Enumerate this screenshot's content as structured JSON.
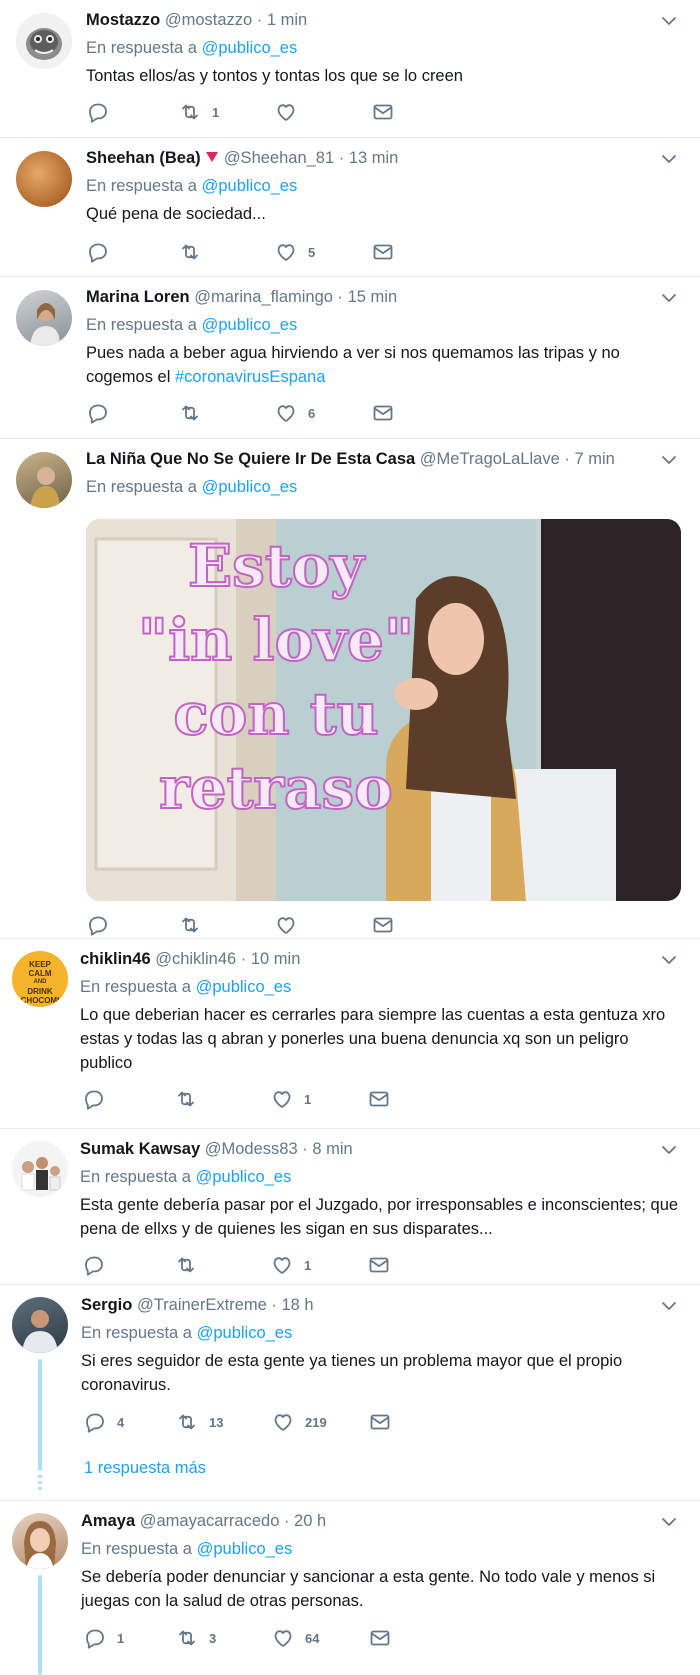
{
  "replying_prefix": "En respuesta a",
  "tweets": [
    {
      "name": "Mostazzo",
      "handle": "@mostazzo",
      "time": "1 min",
      "reply_to": "@publico_es",
      "text": "Tontas ellos/as y tontos y tontas los que se lo creen",
      "counts": {
        "reply": "",
        "retweet": "1",
        "like": "",
        "dm": ""
      }
    },
    {
      "name": "Sheehan (Bea)",
      "handle": "@Sheehan_81",
      "time": "13 min",
      "reply_to": "@publico_es",
      "text": "Qué pena de sociedad...",
      "counts": {
        "reply": "",
        "retweet": "",
        "like": "5",
        "dm": ""
      }
    },
    {
      "name": "Marina Loren",
      "handle": "@marina_flamingo",
      "time": "15 min",
      "reply_to": "@publico_es",
      "text": "Pues nada a beber agua hirviendo a ver si nos quemamos las tripas y no cogemos el ",
      "hashtag": "#coronavirusEspana",
      "counts": {
        "reply": "",
        "retweet": "",
        "like": "6",
        "dm": ""
      }
    },
    {
      "name": "La Niña Que No Se Quiere Ir De Esta Casa",
      "handle": "@MeTragoLaLlave",
      "time": "7 min",
      "reply_to": "@publico_es",
      "media_text": [
        "Estoy",
        "\"in love\"",
        "con tu",
        "retraso"
      ],
      "counts": {
        "reply": "",
        "retweet": "",
        "like": "",
        "dm": ""
      }
    },
    {
      "name": "chiklin46",
      "handle": "@chiklin46",
      "time": "10 min",
      "reply_to": "@publico_es",
      "avatar_text": [
        "KEEP",
        "CALM",
        "AND",
        "DRINK",
        "CHOCOMI"
      ],
      "text": "Lo que deberian hacer es cerrarles para siempre las cuentas a esta gentuza  xro estas y todas las q abran y ponerles una buena denuncia xq son un peligro publico",
      "counts": {
        "reply": "",
        "retweet": "",
        "like": "1",
        "dm": ""
      }
    },
    {
      "name": "Sumak Kawsay",
      "handle": "@Modess83",
      "time": "8 min",
      "reply_to": "@publico_es",
      "text": "Esta gente debería pasar por el Juzgado, por irresponsables e inconscientes; que pena de ellxs y de quienes les sigan en sus disparates...",
      "counts": {
        "reply": "",
        "retweet": "",
        "like": "1",
        "dm": ""
      }
    },
    {
      "name": "Sergio",
      "handle": "@TrainerExtreme",
      "time": "18 h",
      "reply_to": "@publico_es",
      "text": "Si eres seguidor de esta gente ya tienes un problema mayor que el propio coronavirus.",
      "counts": {
        "reply": "4",
        "retweet": "13",
        "like": "219",
        "dm": ""
      },
      "more_replies": "1 respuesta más"
    },
    {
      "name": "Amaya",
      "handle": "@amayacarracedo",
      "time": "20 h",
      "reply_to": "@publico_es",
      "text": "Se debería poder denunciar y sancionar a esta gente. No todo vale y menos si juegas con la salud de otras personas.",
      "counts": {
        "reply": "1",
        "retweet": "3",
        "like": "64",
        "dm": ""
      }
    }
  ],
  "colors": {
    "link": "#1da1f2",
    "muted": "#657786",
    "thread": "#aee1f5",
    "media_text": "#d77fd6"
  },
  "icons": {
    "reply": "reply-icon",
    "retweet": "retweet-icon",
    "like": "heart-icon",
    "dm": "envelope-icon",
    "menu": "chevron-down-icon"
  }
}
